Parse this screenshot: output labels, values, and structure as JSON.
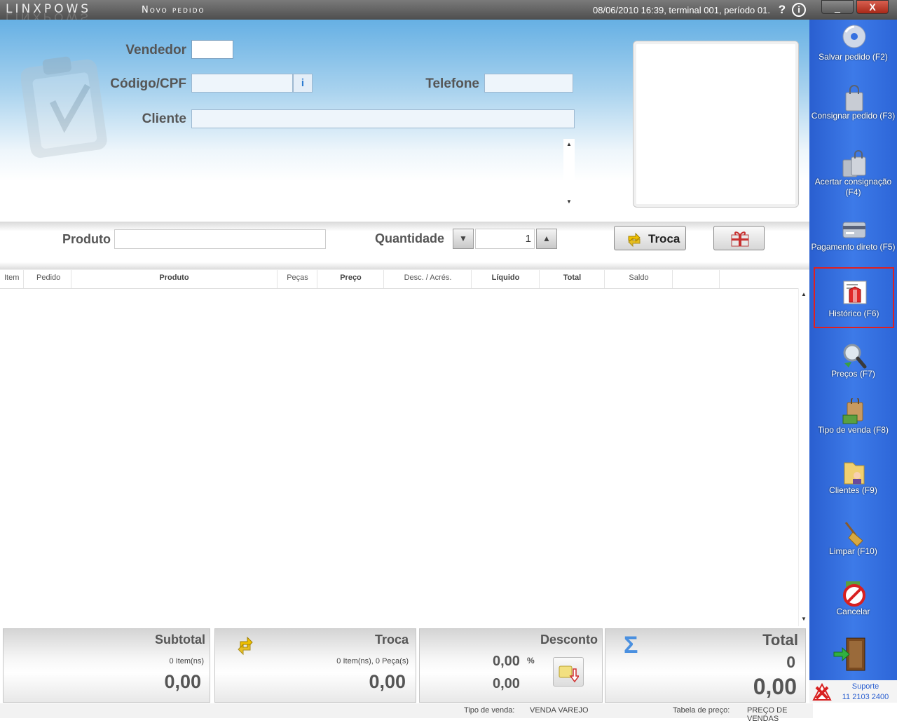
{
  "app": {
    "name": "LINXPOWS",
    "screen_title": "Novo pedido",
    "status": "08/06/2010 16:39, terminal 001, período 01."
  },
  "window": {
    "minimize": "_",
    "close": "X"
  },
  "form": {
    "vendedor_label": "Vendedor",
    "vendedor_value": "",
    "codigo_label": "Código/CPF",
    "codigo_value": "",
    "telefone_label": "Telefone",
    "telefone_value": "",
    "cliente_label": "Cliente",
    "cliente_value": ""
  },
  "product": {
    "label": "Produto",
    "value": "",
    "quantidade_label": "Quantidade",
    "quantidade_value": "1",
    "troca_button": "Troca"
  },
  "table": {
    "columns": [
      "Item",
      "Pedido",
      "Produto",
      "Peças",
      "Preço",
      "Desc. / Acrés.",
      "Líquido",
      "Total",
      "Saldo"
    ],
    "rows": []
  },
  "totals": {
    "subtotal": {
      "title": "Subtotal",
      "items": "0 Item(ns)",
      "value": "0,00"
    },
    "troca": {
      "title": "Troca",
      "items": "0 Item(ns), 0 Peça(s)",
      "value": "0,00"
    },
    "desconto": {
      "title": "Desconto",
      "percent": "0,00",
      "percent_sign": "%",
      "value": "0,00"
    },
    "total": {
      "title": "Total",
      "count": "0",
      "value": "0,00"
    }
  },
  "footer": {
    "tipo_venda_label": "Tipo de venda:",
    "tipo_venda_value": "VENDA VAREJO",
    "tabela_label": "Tabela de preço:",
    "tabela_value": "PREÇO DE VENDAS"
  },
  "sidebar": {
    "items": [
      {
        "label": "Salvar pedido (F2)",
        "icon": "disc-icon"
      },
      {
        "label": "Consignar pedido (F3)",
        "icon": "shopping-bag-icon"
      },
      {
        "label": "Acertar consignação (F4)",
        "icon": "shopping-bags-icon"
      },
      {
        "label": "Pagamento direto (F5)",
        "icon": "credit-card-icon"
      },
      {
        "label": "Histórico (F6)",
        "icon": "history-icon"
      },
      {
        "label": "Preços (F7)",
        "icon": "magnifier-icon"
      },
      {
        "label": "Tipo de venda (F8)",
        "icon": "sale-type-icon"
      },
      {
        "label": "Clientes (F9)",
        "icon": "clients-folder-icon"
      },
      {
        "label": "Limpar (F10)",
        "icon": "broom-icon"
      },
      {
        "label": "Cancelar",
        "icon": "cancel-icon"
      }
    ],
    "support_label": "Suporte",
    "support_phone": "11 2103 2400"
  },
  "colors": {
    "sidebar": "#3470e0",
    "header_gradient_top": "#66b0e4",
    "selected_border": "#e02020"
  }
}
